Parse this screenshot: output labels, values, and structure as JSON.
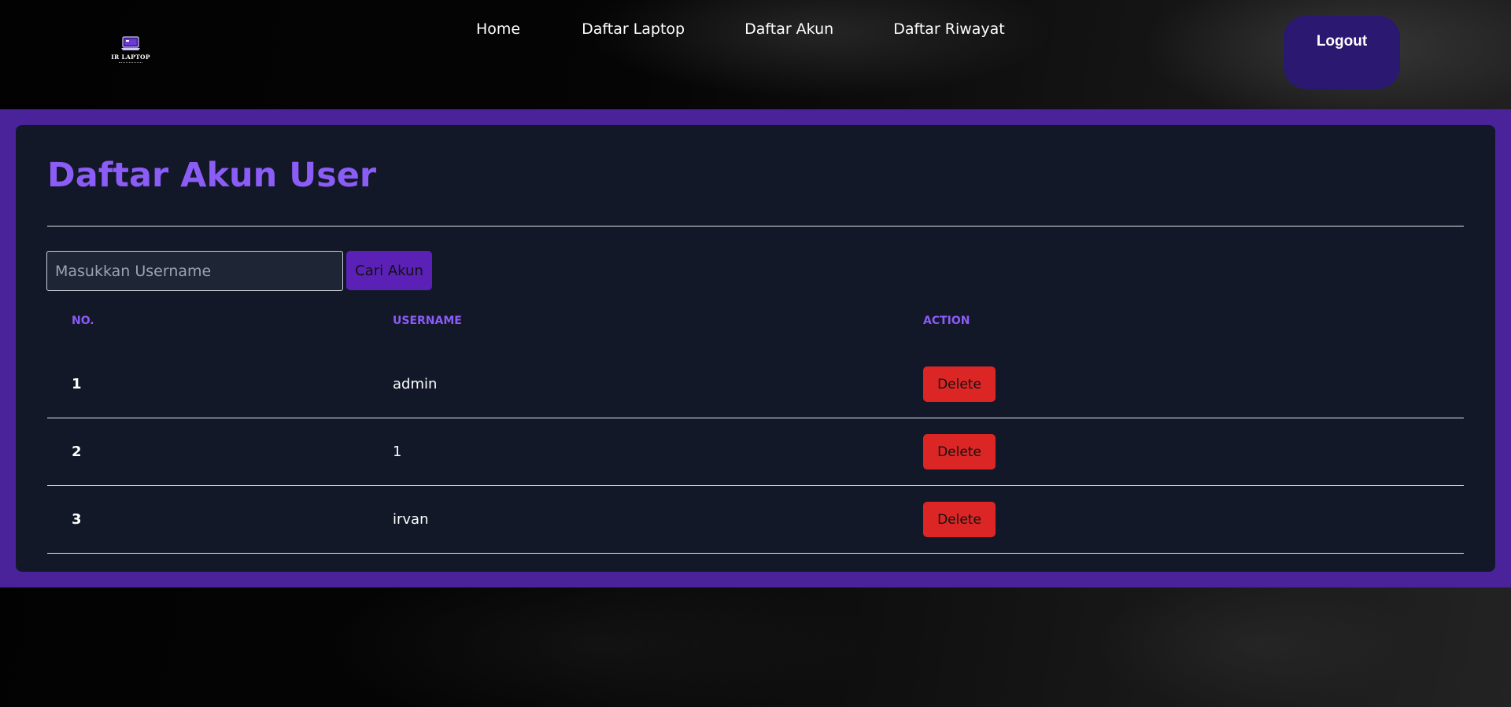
{
  "header": {
    "logo_text": "IR LAPTOP",
    "nav": [
      {
        "label": "Home"
      },
      {
        "label": "Daftar Laptop"
      },
      {
        "label": "Daftar Akun"
      },
      {
        "label": "Daftar Riwayat"
      }
    ],
    "logout_label": "Logout"
  },
  "main": {
    "title": "Daftar Akun User",
    "search": {
      "value": "",
      "placeholder": "Masukkan Username",
      "button_label": "Cari Akun"
    },
    "table": {
      "columns": [
        "NO.",
        "USERNAME",
        "ACTION"
      ],
      "rows": [
        {
          "no": "1",
          "username": "admin",
          "action": "Delete"
        },
        {
          "no": "2",
          "username": "1",
          "action": "Delete"
        },
        {
          "no": "3",
          "username": "irvan",
          "action": "Delete"
        }
      ]
    }
  },
  "colors": {
    "accent": "#8b5cf6",
    "band": "#4a239a",
    "card": "#121828",
    "logout_bg": "#2b1870",
    "search_button": "#5b21b6",
    "delete_button": "#dc2626"
  },
  "icons": {
    "logo": "laptop-icon"
  }
}
